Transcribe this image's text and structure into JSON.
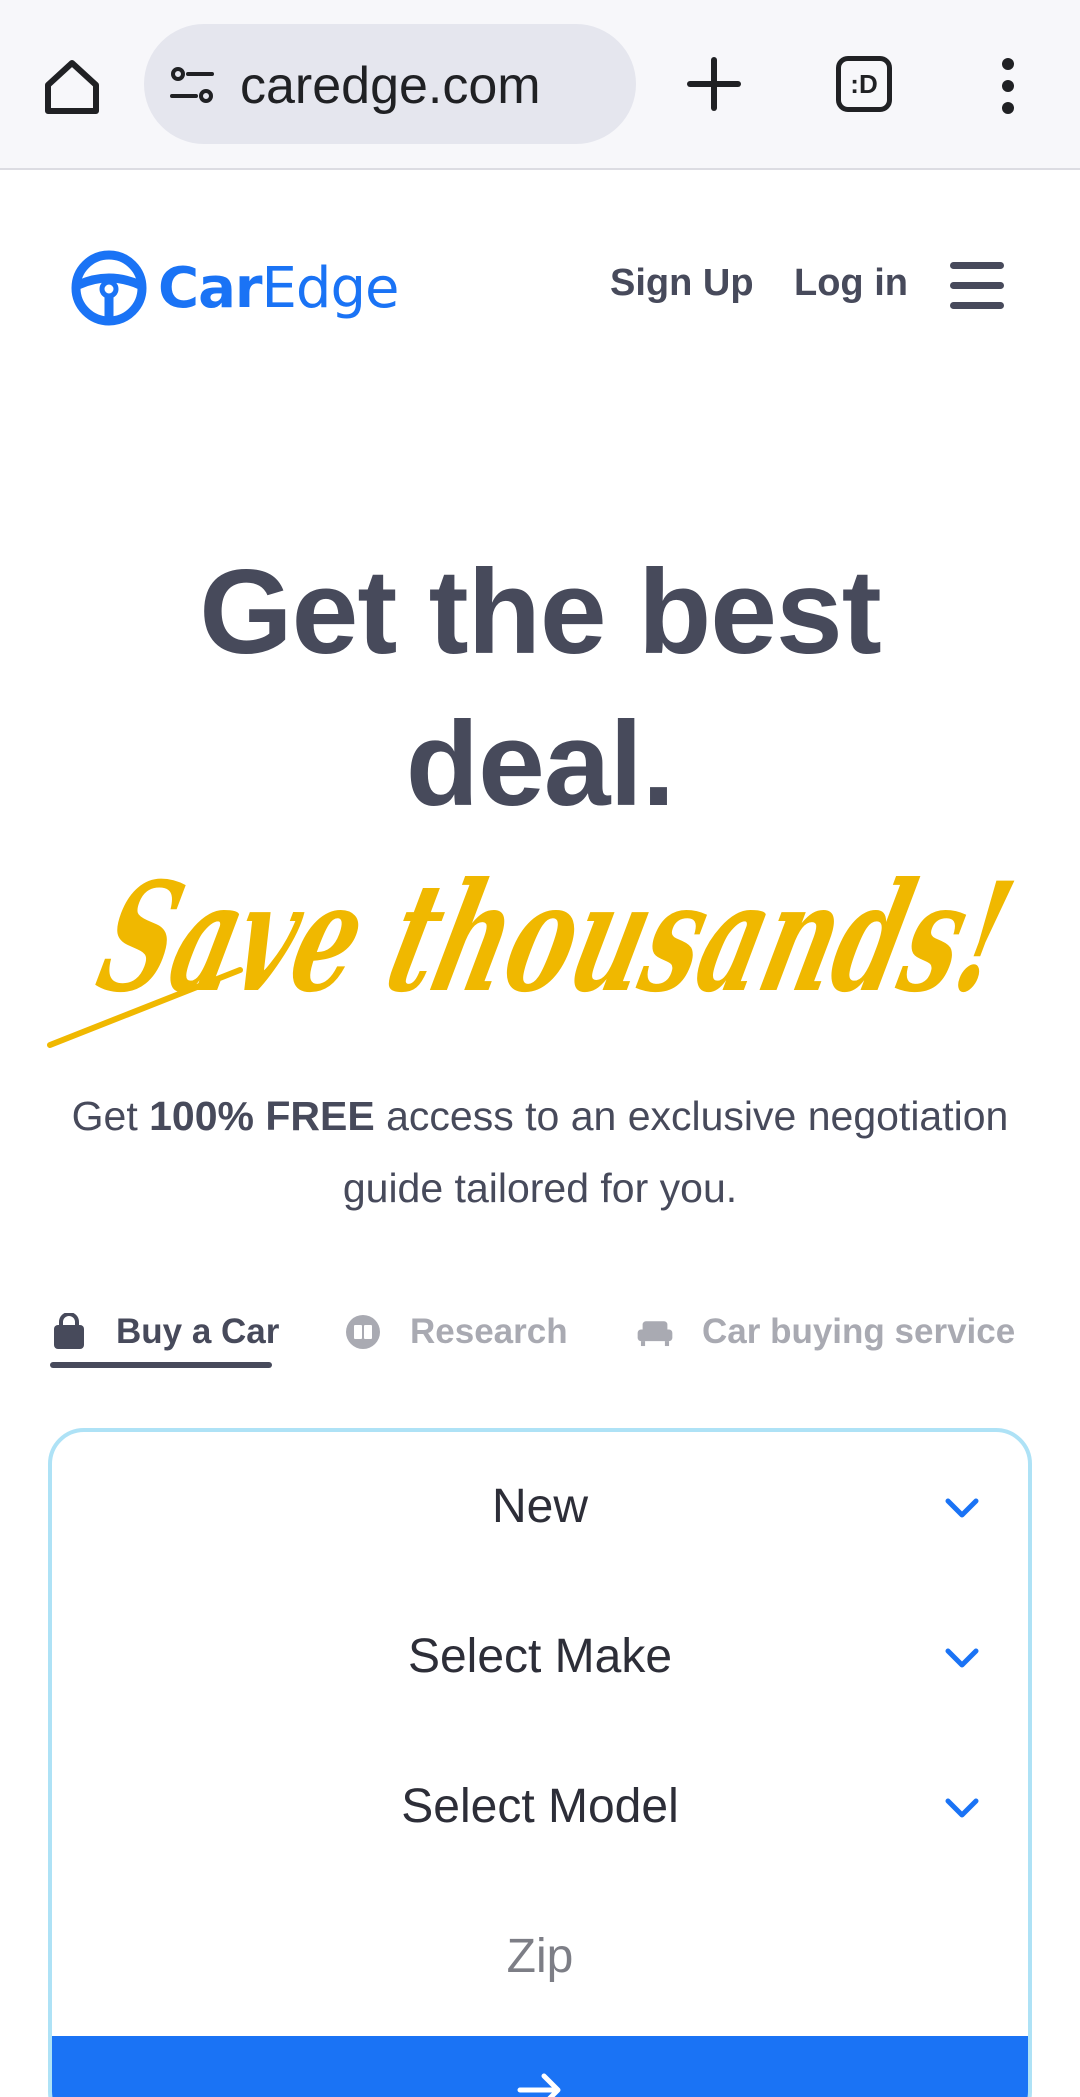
{
  "browser": {
    "url": "caredge.com",
    "tabs_icon_label": ":D"
  },
  "header": {
    "logo": {
      "car": "Car",
      "edge": "Edge"
    },
    "sign_up": "Sign Up",
    "log_in": "Log in"
  },
  "hero": {
    "title_line1": "Get the best",
    "title_line2": "deal.",
    "script_text": "Save thousands!",
    "subtitle_pre": "Get ",
    "subtitle_bold": "100% FREE",
    "subtitle_post": " access to an exclusive negotiation guide tailored for you."
  },
  "tabs": {
    "buy": "Buy a Car",
    "research": "Research",
    "service": "Car buying service",
    "active": "buy"
  },
  "form": {
    "condition": "New",
    "make": "Select Make",
    "model": "Select Model",
    "zip_placeholder": "Zip"
  },
  "colors": {
    "brand_blue": "#1a73f5",
    "script_yellow": "#f0b800",
    "heading": "#474a5b",
    "card_border": "#aee2f6"
  }
}
